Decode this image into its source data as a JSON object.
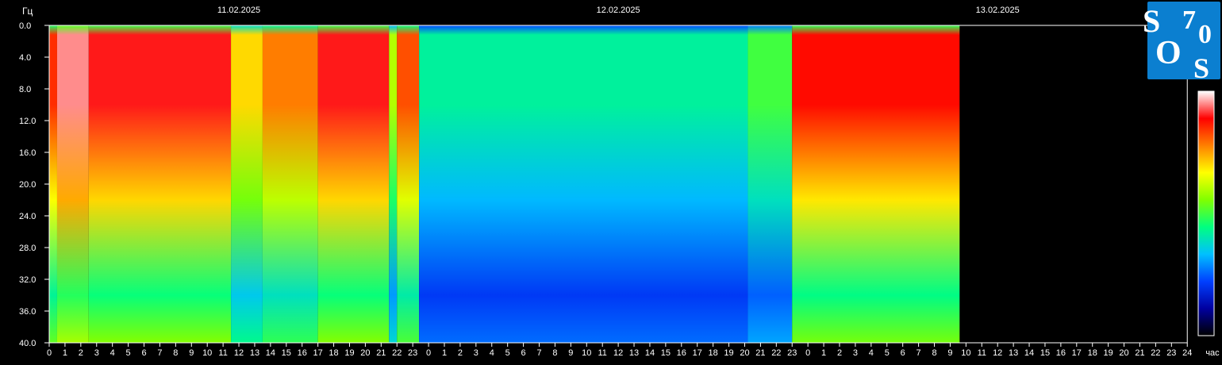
{
  "chart_data": {
    "type": "heatmap",
    "title": "",
    "ylabel": "Гц",
    "xlabel": "час",
    "ylim": [
      0,
      40
    ],
    "y_ticks": [
      "0.0",
      "4.0",
      "8.0",
      "12.0",
      "16.0",
      "20.0",
      "24.0",
      "28.0",
      "32.0",
      "36.0",
      "40.0"
    ],
    "dates": [
      "11.02.2025",
      "12.02.2025",
      "13.02.2025"
    ],
    "x_ticks_day1": [
      "0",
      "1",
      "2",
      "3",
      "4",
      "5",
      "6",
      "7",
      "8",
      "9",
      "10",
      "11",
      "12",
      "13",
      "14",
      "15",
      "16",
      "17",
      "18",
      "19",
      "20",
      "21",
      "22",
      "23"
    ],
    "x_ticks_day2": [
      "0",
      "1",
      "2",
      "3",
      "4",
      "5",
      "6",
      "7",
      "8",
      "9",
      "10",
      "11",
      "12",
      "13",
      "14",
      "15",
      "16",
      "17",
      "18",
      "19",
      "20",
      "21",
      "22",
      "23"
    ],
    "x_ticks_day3": [
      "0",
      "1",
      "2",
      "3",
      "4",
      "5",
      "6",
      "7",
      "8",
      "9",
      "10",
      "11",
      "12",
      "13",
      "14",
      "15",
      "16",
      "17",
      "18",
      "19",
      "20",
      "21",
      "22",
      "23",
      "24"
    ],
    "data_end_hours_day3": 9.6,
    "colorbar": [
      "#000000",
      "#0000a0",
      "#0040ff",
      "#00c0ff",
      "#00ff80",
      "#80ff00",
      "#ffff00",
      "#ff8000",
      "#ff0000",
      "#ffffff"
    ],
    "intensity_segments": [
      {
        "start": 0,
        "end": 0.5,
        "level": 0.85
      },
      {
        "start": 0.5,
        "end": 2.5,
        "level": 0.95
      },
      {
        "start": 2.5,
        "end": 11.5,
        "level": 0.9
      },
      {
        "start": 11.5,
        "end": 13.5,
        "level": 0.7
      },
      {
        "start": 13.5,
        "end": 17,
        "level": 0.78
      },
      {
        "start": 17,
        "end": 21.5,
        "level": 0.9
      },
      {
        "start": 21.5,
        "end": 22,
        "level": 0.6
      },
      {
        "start": 22,
        "end": 23.4,
        "level": 0.82
      },
      {
        "start": 23.4,
        "end": 44.2,
        "level": 0.42
      },
      {
        "start": 44.2,
        "end": 47,
        "level": 0.5
      },
      {
        "start": 47,
        "end": 57.6,
        "level": 0.88
      }
    ]
  },
  "logo": {
    "text_s1": "S",
    "text_7": "7",
    "text_0": "0",
    "text_o": "O",
    "text_s2": "S",
    "bg": "#0b7fd0"
  }
}
